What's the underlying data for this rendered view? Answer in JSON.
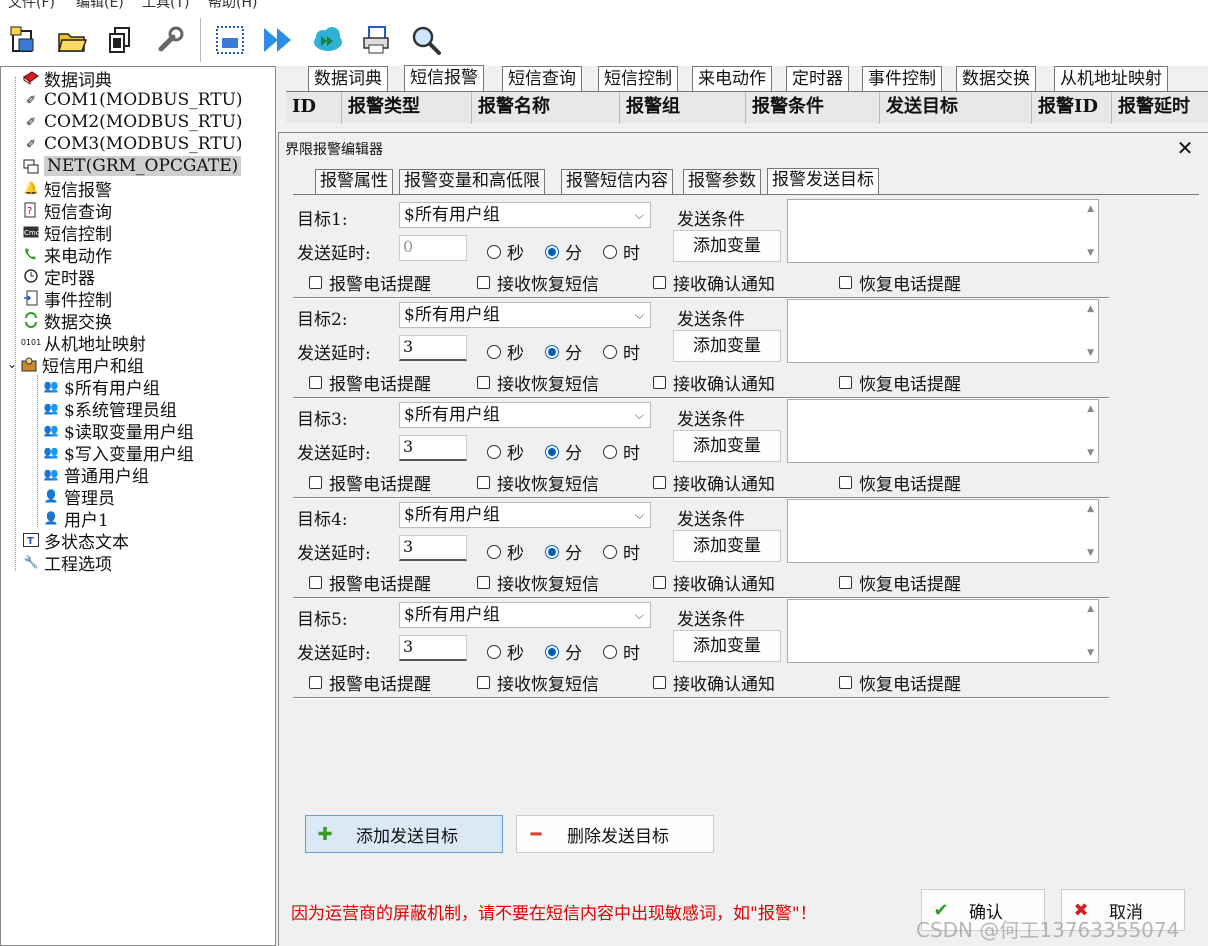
{
  "menubar": {
    "items": [
      "文件(F)",
      "编辑(E)",
      "工具(T)",
      "帮助(H)"
    ]
  },
  "toolbar": {
    "buttons": [
      "new-file-icon",
      "open-folder-icon",
      "copy-icon",
      "wrench-icon",
      "grid-icon",
      "fast-forward-icon",
      "cloud-transfer-icon",
      "printer-icon",
      "search-icon"
    ]
  },
  "tree": {
    "items": [
      {
        "label": "数据词典"
      },
      {
        "label": "COM1(MODBUS_RTU)"
      },
      {
        "label": "COM2(MODBUS_RTU)"
      },
      {
        "label": "COM3(MODBUS_RTU)"
      },
      {
        "label": "NET(GRM_OPCGATE)"
      },
      {
        "label": "短信报警"
      },
      {
        "label": "短信查询"
      },
      {
        "label": "短信控制"
      },
      {
        "label": "来电动作"
      },
      {
        "label": "定时器"
      },
      {
        "label": "事件控制"
      },
      {
        "label": "数据交换"
      },
      {
        "label": "从机地址映射"
      },
      {
        "label": "短信用户和组"
      },
      {
        "label": "$所有用户组"
      },
      {
        "label": "$系统管理员组"
      },
      {
        "label": "$读取变量用户组"
      },
      {
        "label": "$写入变量用户组"
      },
      {
        "label": "普通用户组"
      },
      {
        "label": "管理员"
      },
      {
        "label": "用户1"
      },
      {
        "label": "多状态文本"
      },
      {
        "label": "工程选项"
      }
    ],
    "net_icon_text": "0101"
  },
  "main_tabs": [
    "数据词典",
    "短信报警",
    "短信查询",
    "短信控制",
    "来电动作",
    "定时器",
    "事件控制",
    "数据交换",
    "从机地址映射"
  ],
  "grid_headers": [
    "ID",
    "报警类型",
    "报警名称",
    "报警组",
    "报警条件",
    "发送目标",
    "报警ID",
    "报警延时"
  ],
  "dialog": {
    "title": "界限报警编辑器",
    "close": "✕",
    "tabs": [
      "报警属性",
      "报警变量和高低限",
      "报警短信内容",
      "报警参数",
      "报警发送目标"
    ],
    "labels": {
      "delay": "发送延时:",
      "condition": "发送条件",
      "add_var": "添加变量",
      "sec": "秒",
      "min": "分",
      "hour": "时",
      "alarm_call": "报警电话提醒",
      "recv_recover_sms": "接收恢复短信",
      "recv_confirm": "接收确认通知",
      "recover_call": "恢复电话提醒"
    },
    "targets": [
      {
        "label": "目标1:",
        "group": "$所有用户组",
        "delay": "0"
      },
      {
        "label": "目标2:",
        "group": "$所有用户组",
        "delay": "3"
      },
      {
        "label": "目标3:",
        "group": "$所有用户组",
        "delay": "3"
      },
      {
        "label": "目标4:",
        "group": "$所有用户组",
        "delay": "3"
      },
      {
        "label": "目标5:",
        "group": "$所有用户组",
        "delay": "3"
      }
    ],
    "add_target": "添加发送目标",
    "delete_target": "删除发送目标",
    "warning": "因为运营商的屏蔽机制，请不要在短信内容中出现敏感词，如\"报警\"！",
    "ok": "确认",
    "cancel": "取消"
  },
  "watermark": "CSDN @何工13763355074",
  "colors": {
    "accent": "#005fb8",
    "warning": "#e00000",
    "add_button_bg": "#dbe9f7"
  }
}
